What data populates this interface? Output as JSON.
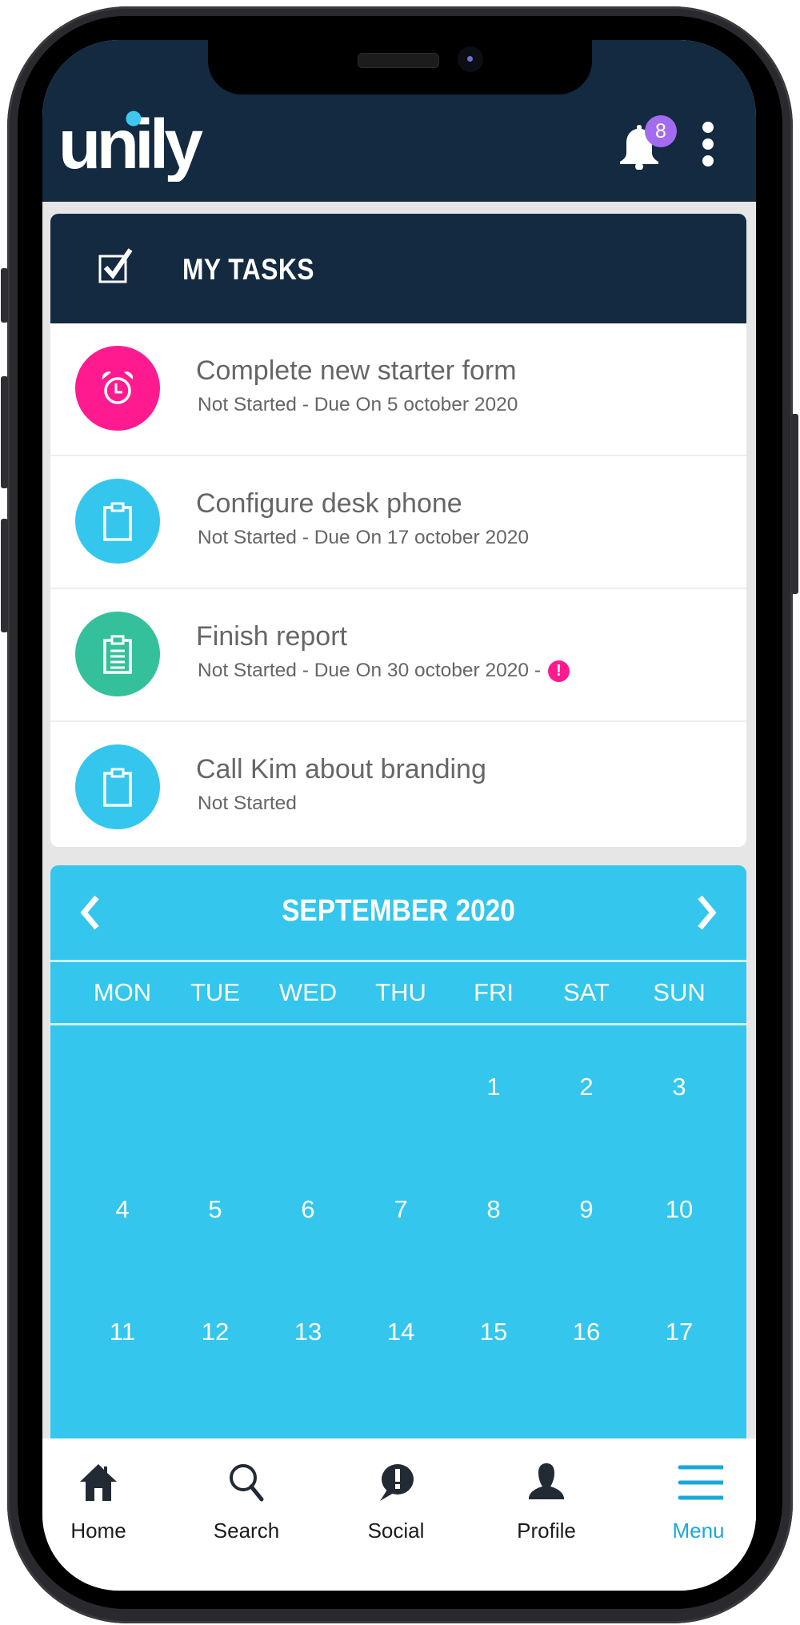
{
  "app": {
    "brand": "unily",
    "notifications": {
      "count": "8",
      "icon": "bell-icon"
    },
    "more_icon": "kebab-menu-icon"
  },
  "colors": {
    "header_bg": "#132a40",
    "accent_blue": "#34c6ed",
    "pink": "#ff1a8f",
    "green": "#34c09a",
    "badge_purple": "#a36cf0",
    "menu_active": "#1aa8dc"
  },
  "tasks": {
    "title": "MY TASKS",
    "icon": "checkbox-icon",
    "items": [
      {
        "title": "Complete new starter form",
        "status": "Not Started - Due On 5 october 2020",
        "icon": "alarm-clock-icon",
        "color": "#ff1a8f",
        "overdue": false
      },
      {
        "title": "Configure desk phone",
        "status": "Not Started - Due On 17 october 2020",
        "icon": "clipboard-icon",
        "color": "#34c6ed",
        "overdue": false
      },
      {
        "title": "Finish report",
        "status": "Not Started - Due On 30 october 2020 -",
        "icon": "clipboard-list-icon",
        "color": "#34c09a",
        "overdue": true,
        "overdue_mark": "!"
      },
      {
        "title": "Call Kim about branding",
        "status": "Not Started",
        "icon": "clipboard-icon",
        "color": "#34c6ed",
        "overdue": false
      }
    ]
  },
  "calendar": {
    "month_label": "SEPTEMBER 2020",
    "prev_icon": "chevron-left-icon",
    "next_icon": "chevron-right-icon",
    "weekdays": [
      "MON",
      "TUE",
      "WED",
      "THU",
      "FRI",
      "SAT",
      "SUN"
    ],
    "weeks": [
      [
        "",
        "",
        "",
        "",
        "1",
        "2",
        "3"
      ],
      [
        "4",
        "5",
        "6",
        "7",
        "8",
        "9",
        "10"
      ],
      [
        "11",
        "12",
        "13",
        "14",
        "15",
        "16",
        "17"
      ]
    ]
  },
  "nav": {
    "items": [
      {
        "label": "Home",
        "icon": "home-icon",
        "active": false
      },
      {
        "label": "Search",
        "icon": "search-icon",
        "active": false
      },
      {
        "label": "Social",
        "icon": "speech-bubble-alert-icon",
        "active": false
      },
      {
        "label": "Profile",
        "icon": "user-icon",
        "active": false
      },
      {
        "label": "Menu",
        "icon": "hamburger-menu-icon",
        "active": true
      }
    ]
  }
}
